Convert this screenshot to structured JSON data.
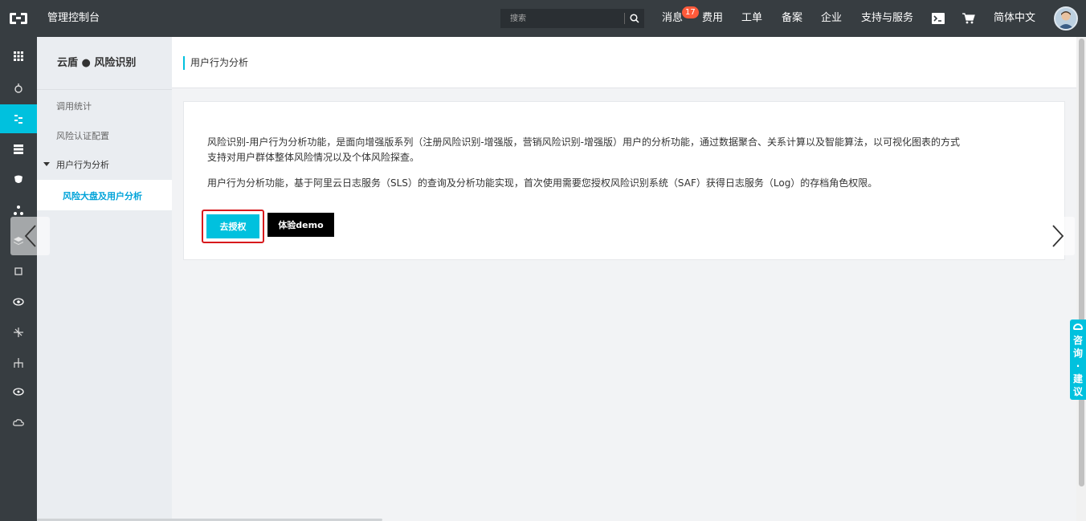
{
  "topbar": {
    "console_title": "管理控制台",
    "search_placeholder": "搜索",
    "nav": {
      "messages": "消息",
      "messages_badge": "17",
      "billing": "费用",
      "tickets": "工单",
      "icp": "备案",
      "enterprise": "企业",
      "support": "支持与服务",
      "language": "简体中文"
    }
  },
  "sidebar": {
    "title": "云盾 ● 风险识别",
    "items": [
      {
        "label": "调用统计"
      },
      {
        "label": "风险认证配置"
      }
    ],
    "group": {
      "label": "用户行为分析",
      "expanded": true
    },
    "active_item": {
      "label": "风险大盘及用户分析"
    }
  },
  "main": {
    "header_title": "用户行为分析",
    "card": {
      "paragraph1_line1": "风险识别-用户行为分析功能，是面向增强版系列（注册风险识别-增强版，营销风险识别-增强版）用户的分析功能，通过数据聚合、关系计算以及智能算法，以可视化图表的方式",
      "paragraph1_line2": "支持对用户群体整体风险情况以及个体风险探查。",
      "paragraph2": "用户行为分析功能，基于阿里云日志服务（SLS）的查询及分析功能实现，首次使用需要您授权风险识别系统（SAF）获得日志服务（Log）的存档角色权限。",
      "authorize_button": "去授权",
      "demo_button": "体验demo"
    }
  },
  "float": {
    "consult_label": "咨询·建议"
  },
  "colors": {
    "topbar_bg": "#373d41",
    "accent": "#00c1de",
    "highlight_border": "#d7191c",
    "badge": "#ff5a3a"
  }
}
